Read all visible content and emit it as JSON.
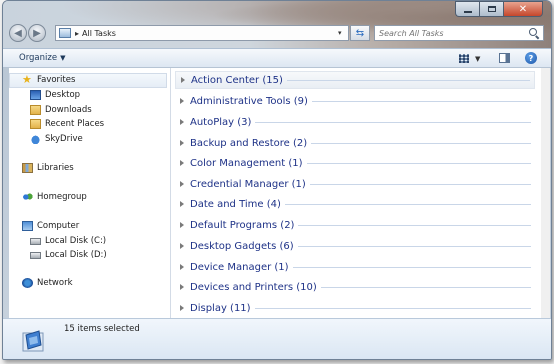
{
  "address": {
    "path": "All Tasks"
  },
  "search": {
    "placeholder": "Search All Tasks"
  },
  "toolbar": {
    "organize_label": "Organize"
  },
  "navigation": {
    "favorites": "Favorites",
    "favorite_items": [
      "Desktop",
      "Downloads",
      "Recent Places",
      "SkyDrive"
    ],
    "libraries": "Libraries",
    "homegroup": "Homegroup",
    "computer": "Computer",
    "drives": [
      "Local Disk (C:)",
      "Local Disk (D:)"
    ],
    "network": "Network"
  },
  "groups": [
    {
      "label": "Action Center (15)"
    },
    {
      "label": "Administrative Tools (9)"
    },
    {
      "label": "AutoPlay (3)"
    },
    {
      "label": "Backup and Restore (2)"
    },
    {
      "label": "Color Management (1)"
    },
    {
      "label": "Credential Manager (1)"
    },
    {
      "label": "Date and Time (4)"
    },
    {
      "label": "Default Programs (2)"
    },
    {
      "label": "Desktop Gadgets (6)"
    },
    {
      "label": "Device Manager (1)"
    },
    {
      "label": "Devices and Printers (10)"
    },
    {
      "label": "Display (11)"
    }
  ],
  "status": {
    "text": "15 items selected"
  },
  "icons": {
    "back": "back-arrow-icon",
    "forward": "forward-arrow-icon",
    "refresh": "refresh-icon",
    "search": "search-icon",
    "views": "view-grid-icon",
    "preview": "preview-pane-icon",
    "help": "help-icon"
  },
  "colors": {
    "group_text": "#1e3287",
    "group_line": "#c9d6e8",
    "status_bg": "#dae6f3"
  }
}
